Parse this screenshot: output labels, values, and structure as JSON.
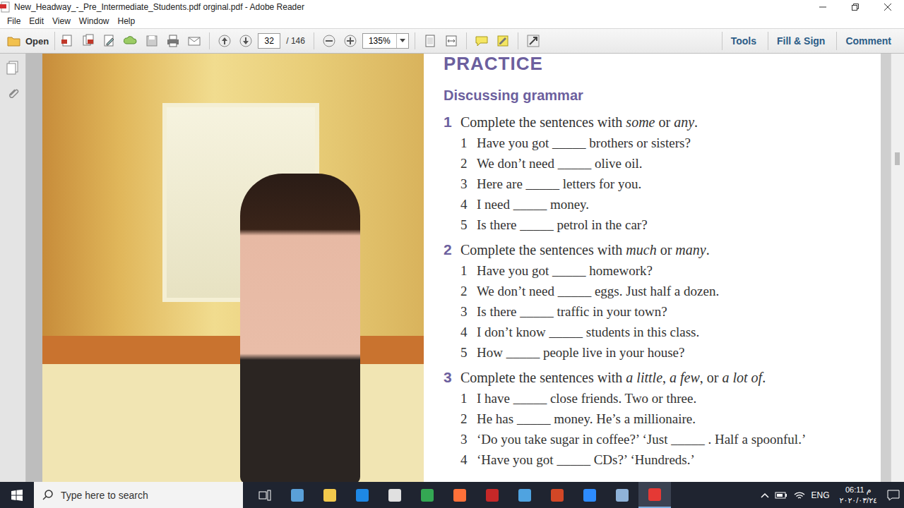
{
  "window": {
    "title": "New_Headway_-_Pre_Intermediate_Students.pdf orginal.pdf - Adobe Reader"
  },
  "menu": [
    "File",
    "Edit",
    "View",
    "Window",
    "Help"
  ],
  "toolbar": {
    "open_label": "Open",
    "page_current": "32",
    "page_total": "/ 146",
    "zoom": "135%",
    "links": [
      "Tools",
      "Fill & Sign",
      "Comment"
    ]
  },
  "document": {
    "heading": "PRACTICE",
    "subheading": "Discussing grammar",
    "exercises": [
      {
        "number": "1",
        "instruction": [
          {
            "text": "Complete the sentences with ",
            "italic": false
          },
          {
            "text": "some",
            "italic": true
          },
          {
            "text": " or ",
            "italic": false
          },
          {
            "text": "any",
            "italic": true
          },
          {
            "text": ".",
            "italic": false
          }
        ],
        "items": [
          {
            "number": "1",
            "text": "Have you got _____ brothers or sisters?"
          },
          {
            "number": "2",
            "text": "We don’t need _____ olive oil."
          },
          {
            "number": "3",
            "text": "Here are _____ letters for you."
          },
          {
            "number": "4",
            "text": "I need _____ money."
          },
          {
            "number": "5",
            "text": "Is there _____ petrol in the car?"
          }
        ]
      },
      {
        "number": "2",
        "instruction": [
          {
            "text": "Complete the sentences with ",
            "italic": false
          },
          {
            "text": "much",
            "italic": true
          },
          {
            "text": " or ",
            "italic": false
          },
          {
            "text": "many",
            "italic": true
          },
          {
            "text": ".",
            "italic": false
          }
        ],
        "items": [
          {
            "number": "1",
            "text": "Have you got _____ homework?"
          },
          {
            "number": "2",
            "text": "We don’t need _____ eggs. Just half a dozen."
          },
          {
            "number": "3",
            "text": "Is there _____ traffic in your town?"
          },
          {
            "number": "4",
            "text": "I don’t know _____ students in this class."
          },
          {
            "number": "5",
            "text": "How _____ people live in your house?"
          }
        ]
      },
      {
        "number": "3",
        "instruction": [
          {
            "text": "Complete the sentences with ",
            "italic": false
          },
          {
            "text": "a little",
            "italic": true
          },
          {
            "text": ", ",
            "italic": false
          },
          {
            "text": "a few",
            "italic": true
          },
          {
            "text": ", or ",
            "italic": false
          },
          {
            "text": "a lot of",
            "italic": true
          },
          {
            "text": ".",
            "italic": false
          }
        ],
        "items": [
          {
            "number": "1",
            "text": "I have _____ close friends. Two or three."
          },
          {
            "number": "2",
            "text": "He has _____ money. He’s a millionaire."
          },
          {
            "number": "3",
            "text": "‘Do you take sugar in coffee?’ ‘Just _____ . Half a spoonful.’"
          },
          {
            "number": "4",
            "text": "‘Have you got _____ CDs?’ ‘Hundreds.’"
          }
        ]
      }
    ]
  },
  "taskbar": {
    "search_placeholder": "Type here to search",
    "apps": [
      {
        "color": "#5aa0d8",
        "selected": false
      },
      {
        "color": "#f2c94c",
        "selected": false
      },
      {
        "color": "#1e88e5",
        "selected": false
      },
      {
        "color": "#e0e0e0",
        "selected": false
      },
      {
        "color": "#34a853",
        "selected": false
      },
      {
        "color": "#ff7139",
        "selected": false
      },
      {
        "color": "#c62828",
        "selected": false
      },
      {
        "color": "#4fa3e0",
        "selected": false
      },
      {
        "color": "#d24726",
        "selected": false
      },
      {
        "color": "#2d8cff",
        "selected": false
      },
      {
        "color": "#8fb3d9",
        "selected": false
      },
      {
        "color": "#e53935",
        "selected": true
      }
    ],
    "language": "ENG",
    "time": "06:11 م",
    "date": "٢٠٢٠/٠٣/٢٤"
  }
}
